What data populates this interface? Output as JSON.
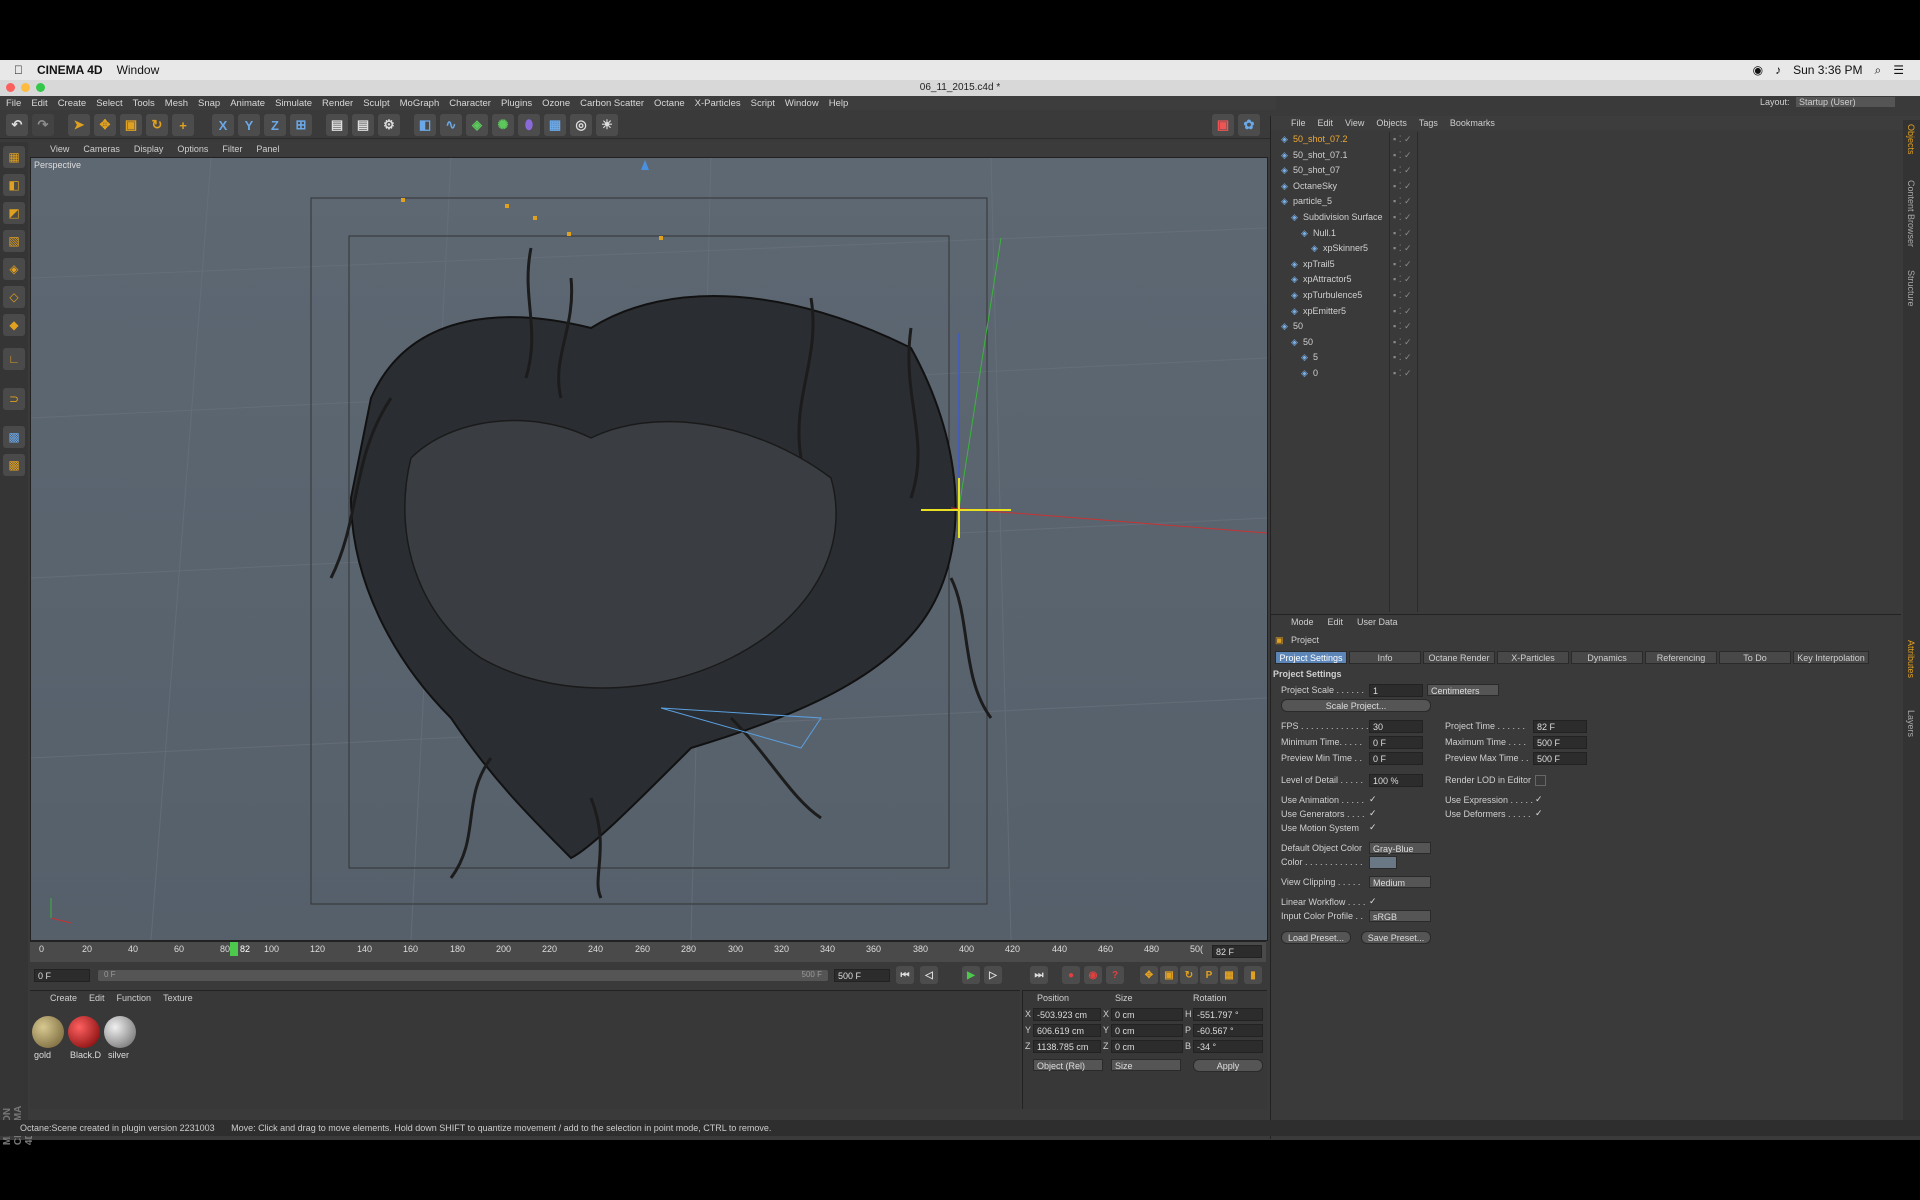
{
  "mac_menubar": {
    "app_name": "CINEMA 4D",
    "window_menu": "Window",
    "clock": "Sun 3:36 PM"
  },
  "titlebar": {
    "title": "06_11_2015.c4d *"
  },
  "main_menu": [
    "File",
    "Edit",
    "Create",
    "Select",
    "Tools",
    "Mesh",
    "Snap",
    "Animate",
    "Simulate",
    "Render",
    "Sculpt",
    "MoGraph",
    "Character",
    "Plugins",
    "Ozone",
    "Carbon Scatter",
    "Octane",
    "X-Particles",
    "Script",
    "Window",
    "Help"
  ],
  "layout": {
    "label": "Layout:",
    "value": "Startup (User)"
  },
  "viewport": {
    "menu": [
      "View",
      "Cameras",
      "Display",
      "Options",
      "Filter",
      "Panel"
    ],
    "label": "Perspective"
  },
  "timeline": {
    "ticks": [
      "0",
      "20",
      "40",
      "60",
      "80",
      "100",
      "120",
      "140",
      "160",
      "180",
      "200",
      "220",
      "240",
      "260",
      "280",
      "300",
      "320",
      "340",
      "360",
      "380",
      "400",
      "420",
      "440",
      "460",
      "480",
      "50("
    ],
    "current_frame": "82",
    "end_field": "82 F",
    "start_field": "0 F",
    "range_start": "0 F",
    "range_end": "500 F",
    "max_field": "500 F"
  },
  "material_panel": {
    "menu": [
      "Create",
      "Edit",
      "Function",
      "Texture"
    ],
    "materials": [
      {
        "name": "gold",
        "color": "#8a7a45"
      },
      {
        "name": "Black.D",
        "color": "#b01818"
      },
      {
        "name": "silver",
        "color": "#9a9a9a"
      }
    ]
  },
  "coordinates": {
    "headers": [
      "Position",
      "Size",
      "Rotation"
    ],
    "rows": [
      {
        "axis": "X",
        "pos": "-503.923 cm",
        "size_axis": "X",
        "size": "0 cm",
        "rot_axis": "H",
        "rot": "-551.797 °"
      },
      {
        "axis": "Y",
        "pos": "606.619 cm",
        "size_axis": "Y",
        "size": "0 cm",
        "rot_axis": "P",
        "rot": "-60.567 °"
      },
      {
        "axis": "Z",
        "pos": "1138.785 cm",
        "size_axis": "Z",
        "size": "0 cm",
        "rot_axis": "B",
        "rot": "-34 °"
      }
    ],
    "mode_dropdown": "Object (Rel)",
    "size_dropdown": "Size",
    "apply": "Apply"
  },
  "status": {
    "left": "Octane:Scene created in plugin version 2231003",
    "message": "Move: Click and drag to move elements. Hold down SHIFT to quantize movement / add to the selection in point mode, CTRL to remove."
  },
  "object_manager": {
    "menu": [
      "File",
      "Edit",
      "View",
      "Objects",
      "Tags",
      "Bookmarks"
    ],
    "objects": [
      {
        "name": "50_shot_07.2",
        "indent": 0,
        "highlight": true
      },
      {
        "name": "50_shot_07.1",
        "indent": 0,
        "highlight": false
      },
      {
        "name": "50_shot_07",
        "indent": 0,
        "highlight": false
      },
      {
        "name": "OctaneSky",
        "indent": 0,
        "highlight": false
      },
      {
        "name": "particle_5",
        "indent": 0,
        "highlight": false
      },
      {
        "name": "Subdivision Surface",
        "indent": 1,
        "highlight": false
      },
      {
        "name": "Null.1",
        "indent": 2,
        "highlight": false
      },
      {
        "name": "xpSkinner5",
        "indent": 3,
        "highlight": false
      },
      {
        "name": "xpTrail5",
        "indent": 1,
        "highlight": false
      },
      {
        "name": "xpAttractor5",
        "indent": 1,
        "highlight": false
      },
      {
        "name": "xpTurbulence5",
        "indent": 1,
        "highlight": false
      },
      {
        "name": "xpEmitter5",
        "indent": 1,
        "highlight": false
      },
      {
        "name": "50",
        "indent": 0,
        "highlight": false
      },
      {
        "name": "50",
        "indent": 1,
        "highlight": false
      },
      {
        "name": "5",
        "indent": 2,
        "highlight": false
      },
      {
        "name": "0",
        "indent": 2,
        "highlight": false
      }
    ]
  },
  "attributes": {
    "menu": [
      "Mode",
      "Edit",
      "User Data"
    ],
    "object": "Project",
    "tabs": [
      "Project Settings",
      "Info",
      "Octane Render",
      "X-Particles",
      "Dynamics",
      "Referencing",
      "To Do",
      "Key Interpolation"
    ],
    "section": "Project Settings",
    "project_scale_label": "Project Scale . . . . . .",
    "project_scale_value": "1",
    "project_scale_unit": "Centimeters",
    "scale_project_button": "Scale Project...",
    "fps_label": "FPS . . . . . . . . . . . . . .",
    "fps_value": "30",
    "project_time_label": "Project Time . . . . . .",
    "project_time_value": "82 F",
    "min_time_label": "Minimum Time. . . . .",
    "min_time_value": "0 F",
    "max_time_label": "Maximum Time . . . .",
    "max_time_value": "500 F",
    "prev_min_label": "Preview Min Time . .",
    "prev_min_value": "0 F",
    "prev_max_label": "Preview Max Time . .",
    "prev_max_value": "500 F",
    "lod_label": "Level of Detail . . . . .",
    "lod_value": "100 %",
    "render_lod_label": "Render LOD in Editor",
    "use_animation": "Use Animation . . . . .",
    "use_expression": "Use Expression . . . . .",
    "use_generators": "Use Generators . . . .",
    "use_deformers": "Use Deformers . . . . .",
    "use_motion": "Use Motion System",
    "default_color_label": "Default Object Color",
    "default_color_value": "Gray-Blue",
    "color_label": "Color . . . . . . . . . . . .",
    "view_clipping_label": "View Clipping . . . . .",
    "view_clipping_value": "Medium",
    "linear_workflow": "Linear Workflow . . . .",
    "input_color_label": "Input Color Profile . .",
    "input_color_value": "sRGB",
    "load_preset": "Load Preset...",
    "save_preset": "Save Preset..."
  },
  "side_tabs": [
    "Objects",
    "Content Browser",
    "Structure",
    "Attributes",
    "Layers"
  ],
  "brand": "MAXON CINEMA 4D",
  "colors": {
    "accent_blue": "#5b86b7",
    "tool_orange": "#e0a020",
    "viewport": "#5a646f"
  }
}
